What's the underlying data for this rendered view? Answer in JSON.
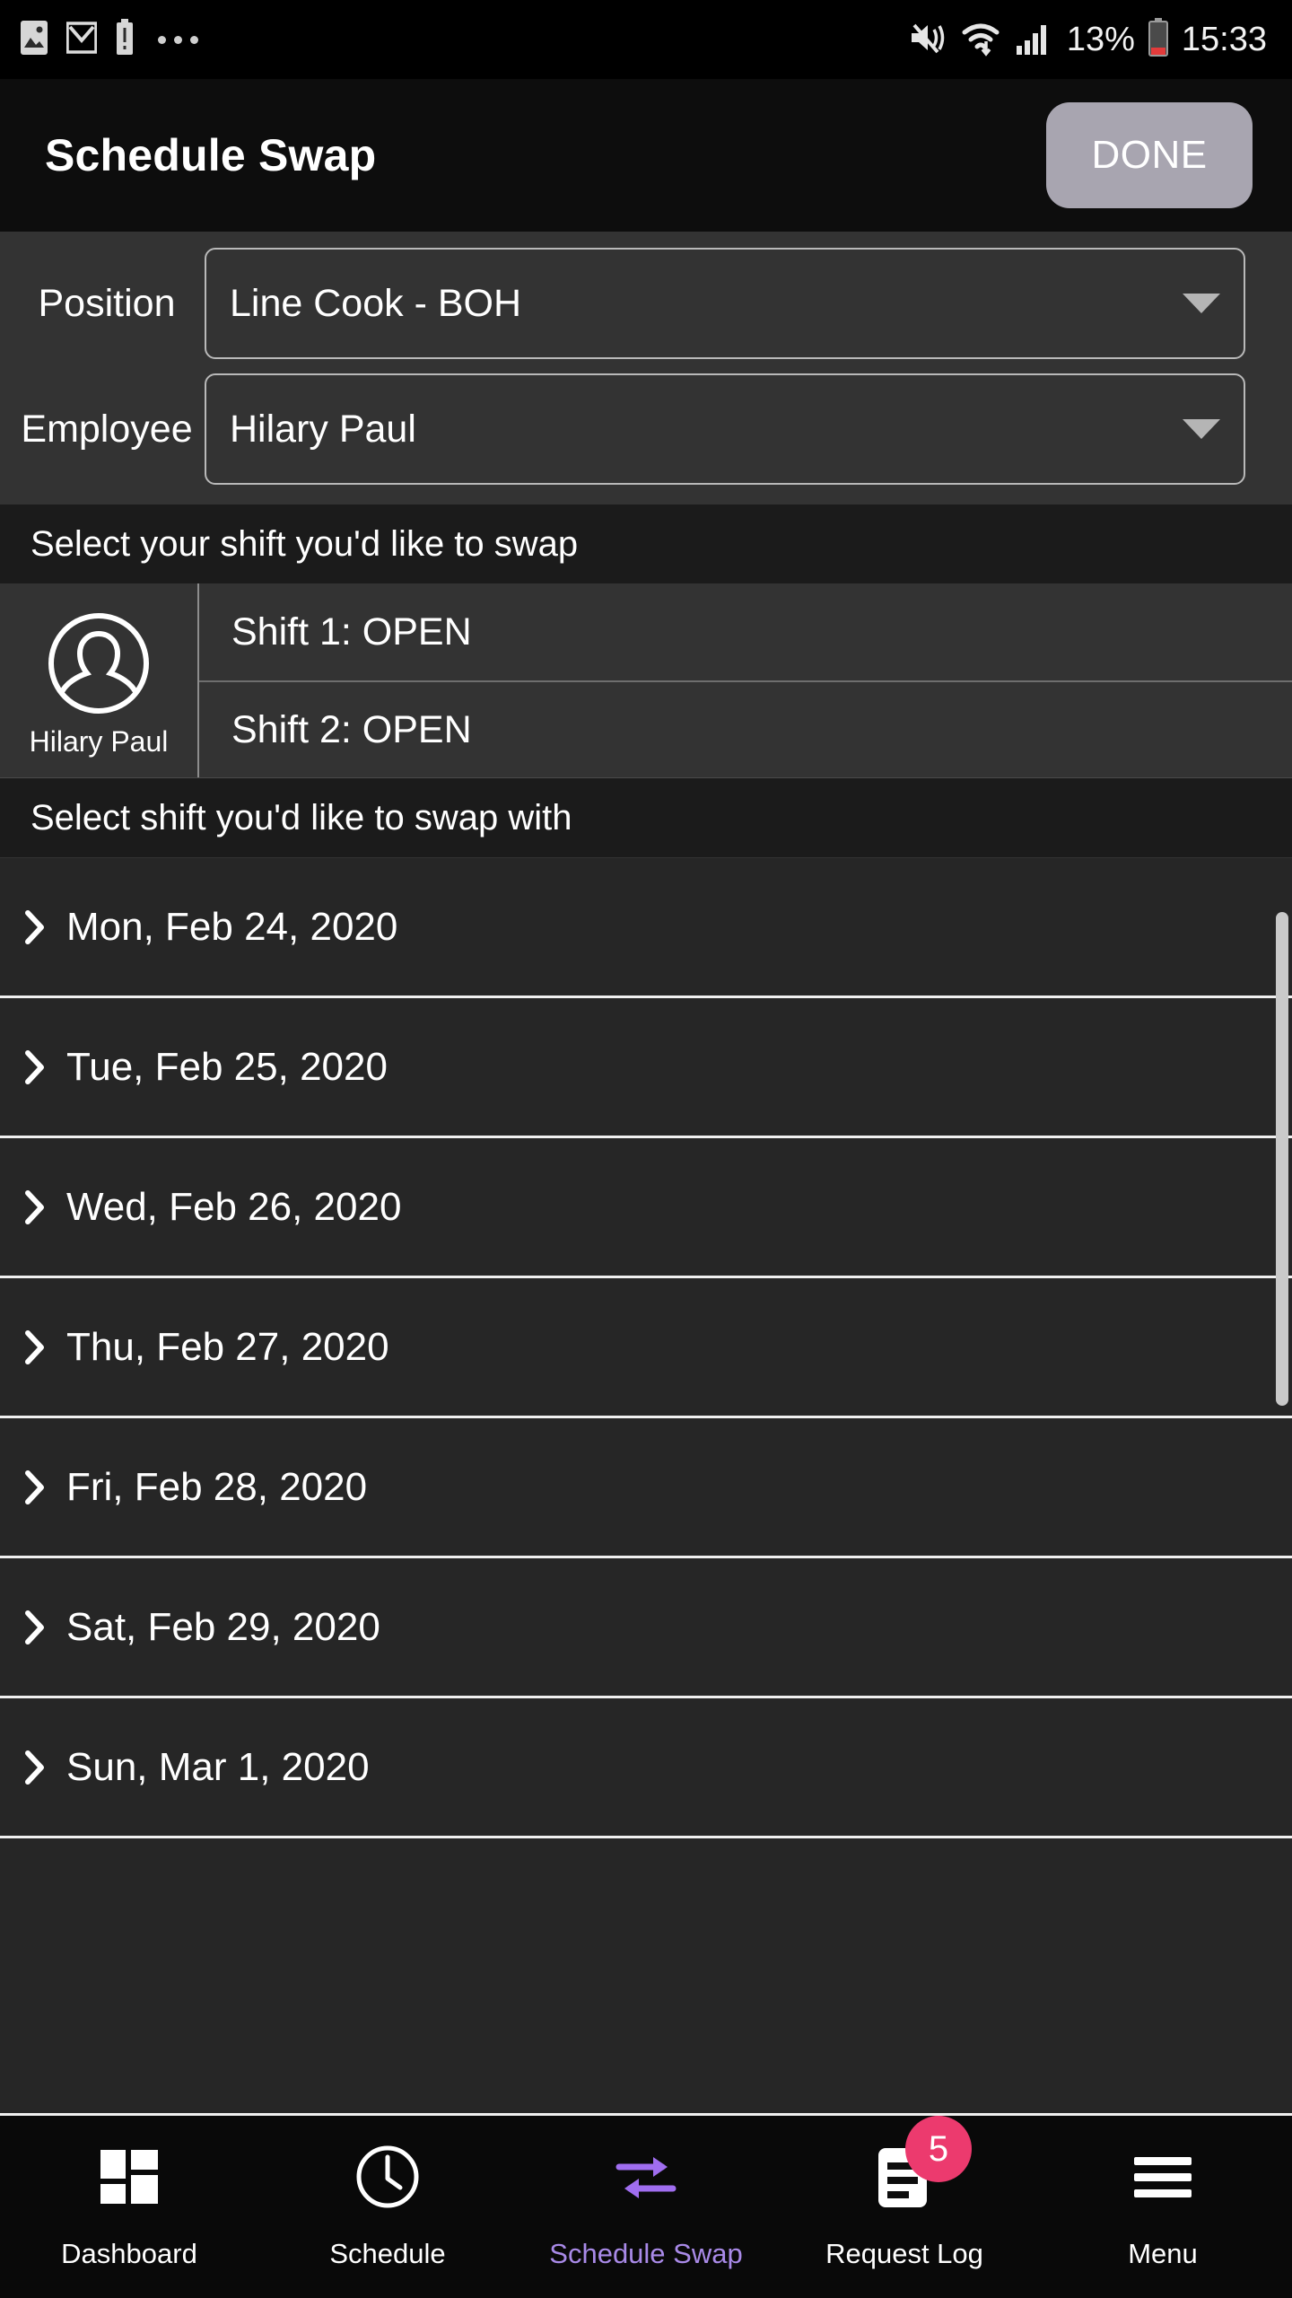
{
  "statusbar": {
    "left_icons": [
      "image-icon",
      "gmail-icon",
      "battery-alert-icon",
      "more-dots-icon"
    ],
    "right_icons": [
      "mute-vibrate-icon",
      "wifi-icon",
      "cell-signal-icon",
      "battery-icon"
    ],
    "battery_percent": "13%",
    "time": "15:33"
  },
  "appbar": {
    "title": "Schedule Swap",
    "done_label": "DONE"
  },
  "form": {
    "position": {
      "label": "Position",
      "value": "Line Cook - BOH"
    },
    "employee": {
      "label": "Employee",
      "value": "Hilary  Paul"
    }
  },
  "my_shift_section": {
    "header": "Select your shift you'd like to swap",
    "employee_name": "Hilary  Paul",
    "shifts": [
      {
        "label": "Shift 1: OPEN"
      },
      {
        "label": "Shift 2: OPEN"
      }
    ]
  },
  "swap_section": {
    "header": "Select  shift you'd like to swap with",
    "dates": [
      {
        "label": "Mon, Feb 24, 2020"
      },
      {
        "label": "Tue, Feb 25, 2020"
      },
      {
        "label": "Wed, Feb 26, 2020"
      },
      {
        "label": "Thu, Feb 27, 2020"
      },
      {
        "label": "Fri, Feb 28, 2020"
      },
      {
        "label": "Sat, Feb 29, 2020"
      },
      {
        "label": "Sun, Mar 1, 2020"
      }
    ]
  },
  "bottom_nav": {
    "items": [
      {
        "label": "Dashboard",
        "icon": "dashboard-grid-icon",
        "active": false,
        "badge": ""
      },
      {
        "label": "Schedule",
        "icon": "clock-icon",
        "active": false,
        "badge": ""
      },
      {
        "label": "Schedule Swap",
        "icon": "swap-arrows-icon",
        "active": true,
        "badge": ""
      },
      {
        "label": "Request Log",
        "icon": "document-icon",
        "active": false,
        "badge": "5"
      },
      {
        "label": "Menu",
        "icon": "hamburger-menu-icon",
        "active": false,
        "badge": ""
      }
    ]
  },
  "colors": {
    "accent_purple": "#a98ae8",
    "badge_pink": "#ec3a6e",
    "done_button": "#a8a5b0",
    "form_bg": "#333333",
    "list_bg": "#262626",
    "section_header_bg": "#1b1b1b"
  }
}
